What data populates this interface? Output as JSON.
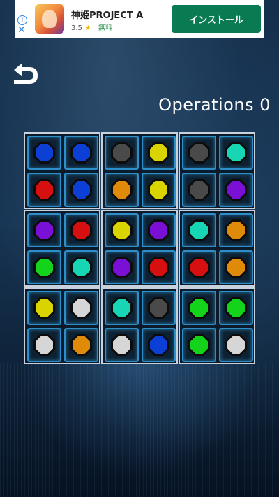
{
  "ad": {
    "info_glyph": "i",
    "close_glyph": "✕",
    "title": "神姫PROJECT A",
    "rating": "3.5",
    "star_glyph": "★",
    "price": "無料",
    "install_label": "インストール"
  },
  "header": {
    "operations_label": "Operations",
    "operations_count": "0"
  },
  "colors": {
    "blue": "#0b3fd6",
    "gray": "#4a4a4a",
    "yellow": "#d9d400",
    "teal": "#17d6b3",
    "red": "#d61010",
    "orange": "#df8a09",
    "purple": "#7a10d6",
    "green": "#13d41b",
    "white": "#d6d6d6"
  },
  "board": {
    "blocks": [
      [
        "blue",
        "blue",
        "red",
        "blue"
      ],
      [
        "gray",
        "yellow",
        "orange",
        "yellow"
      ],
      [
        "gray",
        "teal",
        "gray",
        "purple"
      ],
      [
        "purple",
        "red",
        "green",
        "teal"
      ],
      [
        "yellow",
        "purple",
        "purple",
        "red"
      ],
      [
        "teal",
        "orange",
        "red",
        "orange"
      ],
      [
        "yellow",
        "white",
        "white",
        "orange"
      ],
      [
        "teal",
        "gray",
        "white",
        "blue"
      ],
      [
        "green",
        "green",
        "green",
        "white"
      ]
    ]
  }
}
